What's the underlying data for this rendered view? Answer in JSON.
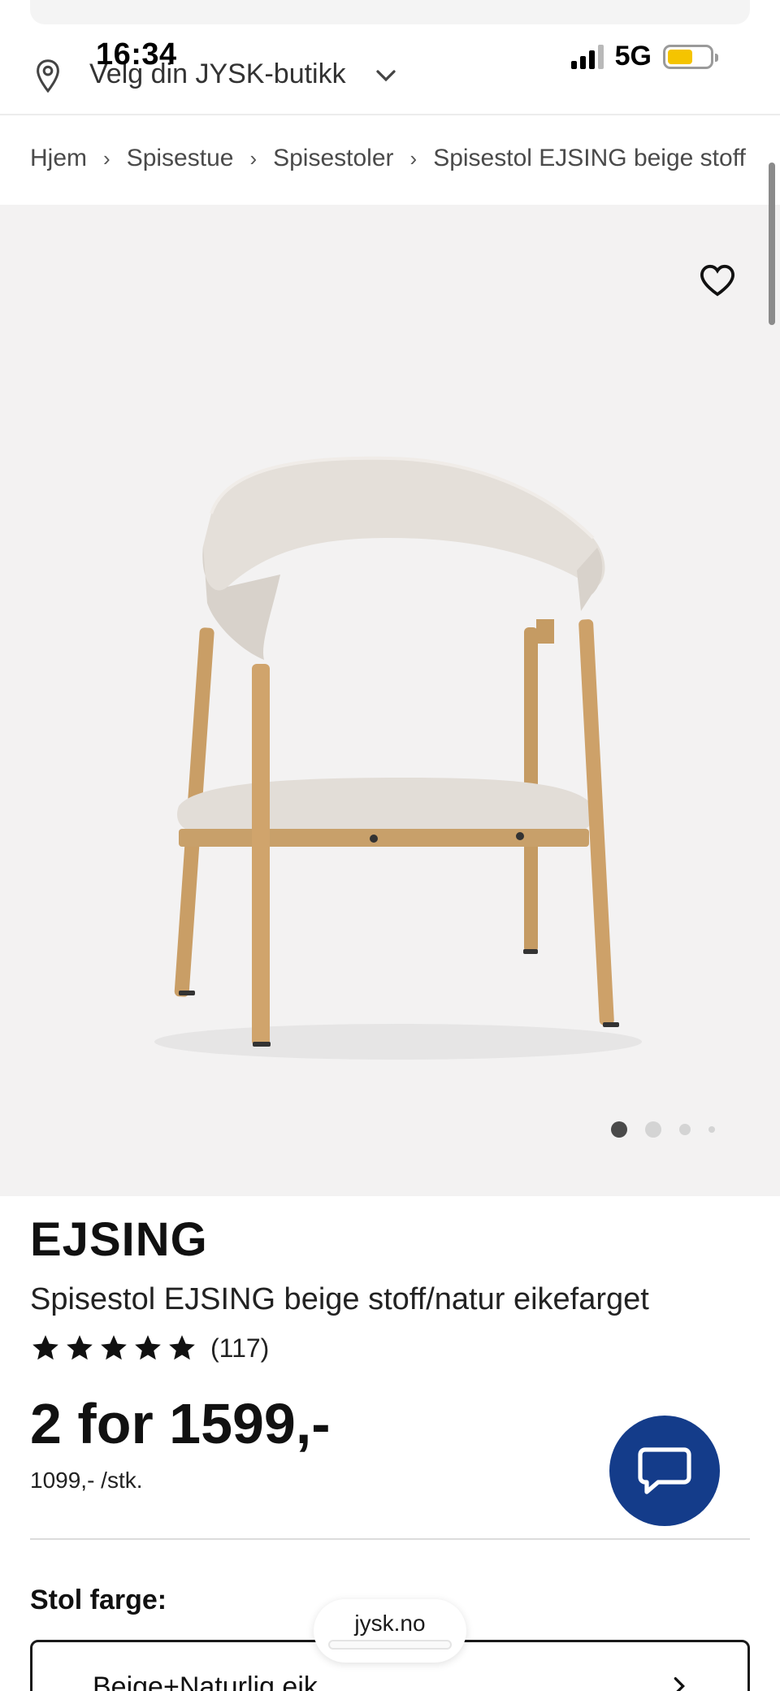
{
  "status_bar": {
    "time": "16:34",
    "network": "5G"
  },
  "store_selector": {
    "label": "Velg din JYSK-butikk"
  },
  "breadcrumb": [
    {
      "label": "Hjem"
    },
    {
      "label": "Spisestue"
    },
    {
      "label": "Spisestoler"
    },
    {
      "label": "Spisestol EJSING beige stoff"
    }
  ],
  "gallery": {
    "image_count": 4,
    "active_index": 0
  },
  "product": {
    "brand": "EJSING",
    "name": "Spisestol EJSING beige stoff/natur eikefarget",
    "rating": {
      "stars": 5,
      "count": "(117)"
    },
    "price": "2 for 1599,-",
    "unit_price": "1099,- /stk."
  },
  "color_section": {
    "label": "Stol farge:",
    "selected": "Beige+Naturlig eik"
  },
  "browser": {
    "domain": "jysk.no"
  },
  "colors": {
    "chat_button": "#143c8a",
    "battery": "#f5c400",
    "gallery_bg": "#f3f2f2"
  },
  "icons": [
    "location-pin-icon",
    "chevron-down-icon",
    "chevron-right-icon",
    "heart-icon",
    "star-icon",
    "chat-icon"
  ]
}
